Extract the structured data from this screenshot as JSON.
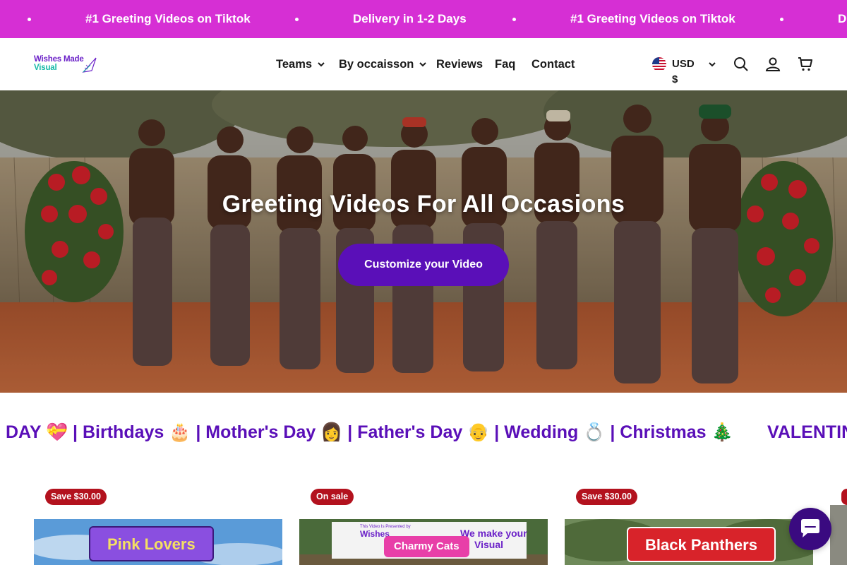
{
  "announcement": {
    "items": [
      "#1 Greeting Videos on Tiktok",
      "Delivery in 1-2 Days",
      "#1 Greeting Videos on Tiktok",
      "D"
    ],
    "bg_color": "#d62fd4"
  },
  "header": {
    "logo": {
      "line1": "Wishes Made",
      "line2": "Visual"
    },
    "nav": [
      {
        "label": "Teams",
        "has_dropdown": true
      },
      {
        "label": "By occaisson",
        "has_dropdown": true
      },
      {
        "label": "Reviews",
        "has_dropdown": false
      },
      {
        "label": "Faq",
        "has_dropdown": false
      },
      {
        "label": "Contact",
        "has_dropdown": false
      }
    ],
    "currency": "USD $",
    "icons": [
      "search-icon",
      "account-icon",
      "cart-icon"
    ]
  },
  "hero": {
    "title": "Greeting Videos For All Occasions",
    "cta_label": "Customize your Video",
    "cta_color": "#5a0fb8"
  },
  "occasions": {
    "line": "DAY 💝 | Birthdays 🎂 | Mother's Day 👩 | Father's Day 👴 | Wedding 💍 | Christmas 🎄",
    "next": "VALENTIN",
    "color": "#5a0fb8"
  },
  "products": [
    {
      "badge": "Save $30.00",
      "label": "Pink Lovers"
    },
    {
      "badge": "On sale",
      "label": "Charmy Cats",
      "banner_text": "We make your",
      "banner_text2": "Visual",
      "banner_small": "This Video Is Presented by",
      "banner_brand": "Wishes"
    },
    {
      "badge": "Save $30.00",
      "label": "Black Panthers"
    }
  ],
  "colors": {
    "accent": "#5a0fb8",
    "sale_badge": "#b3121e",
    "chat": "#3a0a80"
  }
}
